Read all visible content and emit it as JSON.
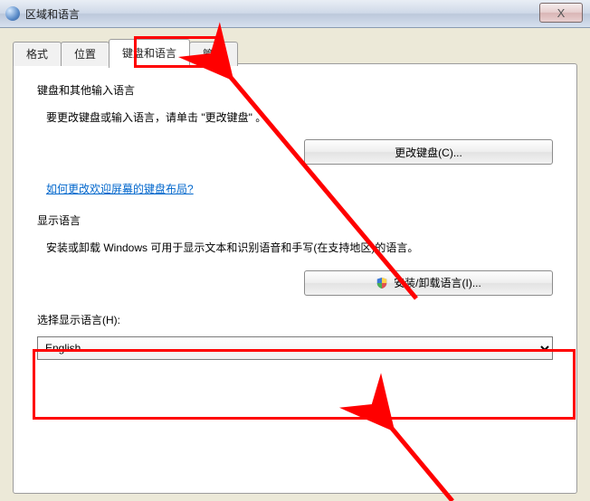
{
  "window": {
    "title": "区域和语言",
    "close_glyph": "X"
  },
  "tabs": {
    "t0": "格式",
    "t1": "位置",
    "t2": "键盘和语言",
    "t3": "管理"
  },
  "section1": {
    "title": "键盘和其他输入语言",
    "text": "要更改键盘或输入语言，请单击 \"更改键盘\" 。",
    "button": "更改键盘(C)...",
    "link": "如何更改欢迎屏幕的键盘布局?"
  },
  "section2": {
    "title": "显示语言",
    "text": "安装或卸载 Windows 可用于显示文本和识别语音和手写(在支持地区)的语言。",
    "button": "安装/卸载语言(I)...",
    "select_label": "选择显示语言(H):",
    "select_value": "English"
  },
  "colors": {
    "annotation": "#ff0000"
  }
}
